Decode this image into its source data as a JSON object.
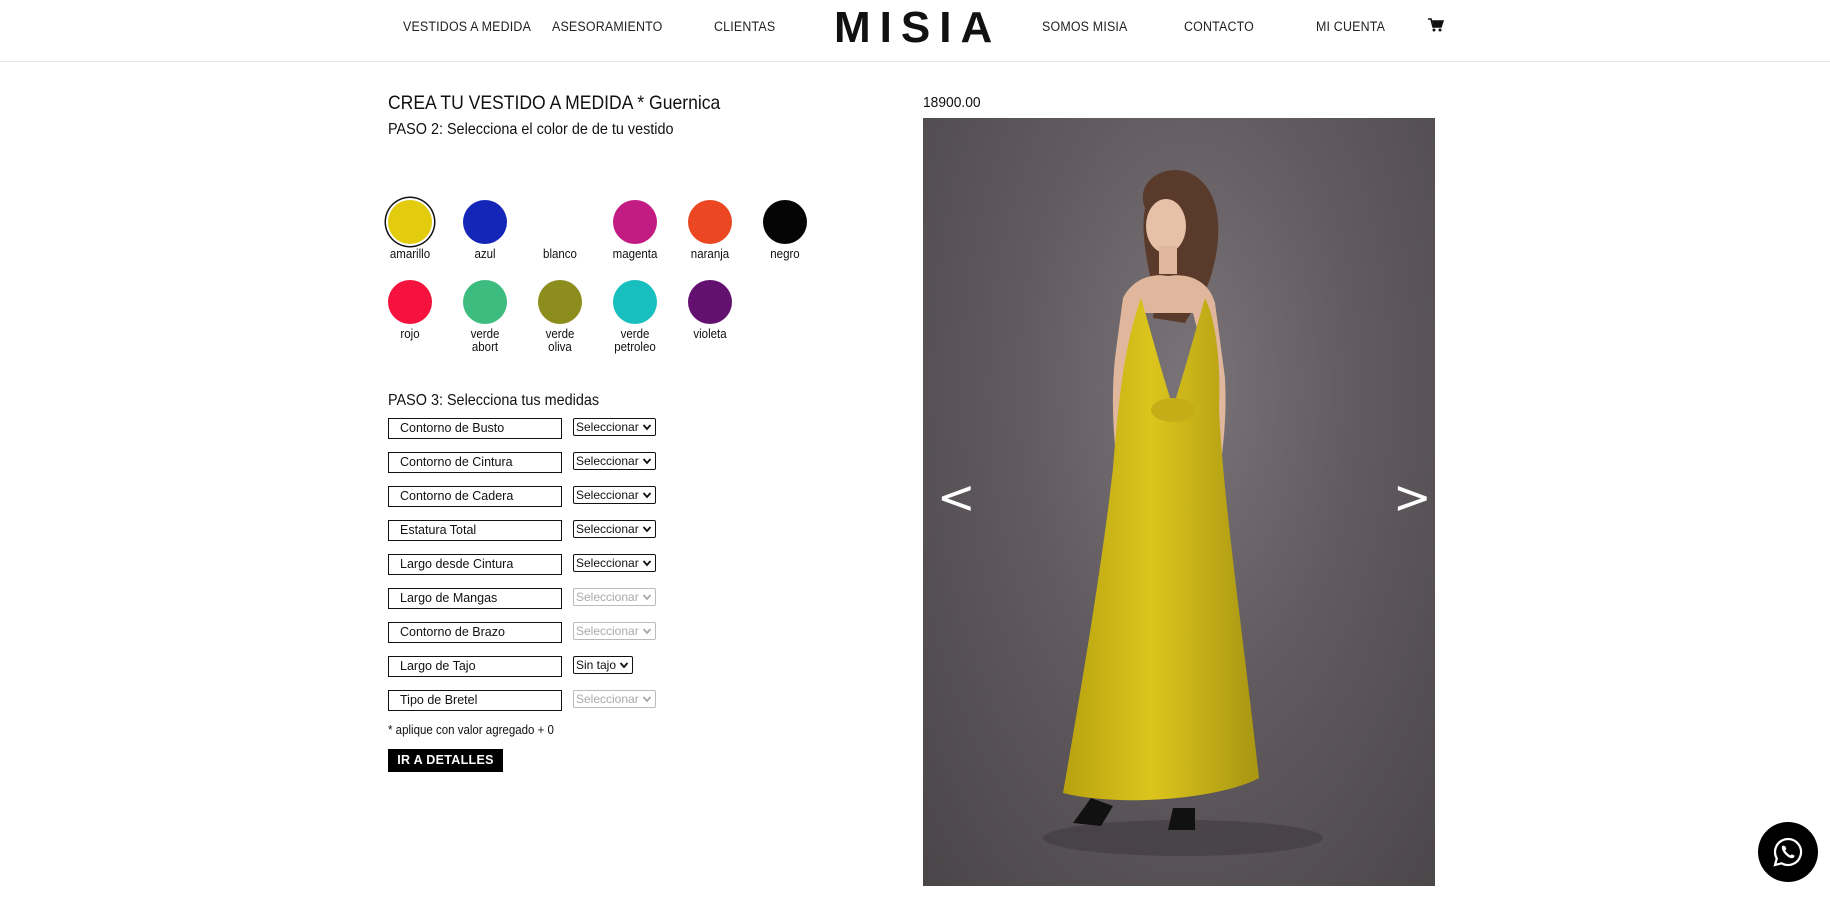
{
  "nav": {
    "vestidos": "VESTIDOS A MEDIDA",
    "asesoramiento": "ASESORAMIENTO",
    "clientas": "CLIENTAS",
    "logo": "MISIA",
    "somos": "SOMOS MISIA",
    "contacto": "CONTACTO",
    "cuenta": "MI CUENTA",
    "cart_icon": "cart-icon"
  },
  "product": {
    "title": "CREA TU VESTIDO A MEDIDA * Guernica",
    "step2": "PASO 2: Selecciona el color de de tu vestido",
    "price": "18900.00"
  },
  "colors": [
    {
      "name": "amarillo",
      "hex": "#e3cc0e",
      "selected": true
    },
    {
      "name": "azul",
      "hex": "#1326b8"
    },
    {
      "name": "blanco",
      "hex": "#ffffff"
    },
    {
      "name": "magenta",
      "hex": "#c21c83"
    },
    {
      "name": "naranja",
      "hex": "#ea4722"
    },
    {
      "name": "negro",
      "hex": "#050505"
    },
    {
      "name": "rojo",
      "hex": "#f5133d"
    },
    {
      "name": "verde abort",
      "hex": "#3cbd7f"
    },
    {
      "name": "verde oliva",
      "hex": "#8c8d1c"
    },
    {
      "name": "verde petroleo",
      "hex": "#17bfbe"
    },
    {
      "name": "violeta",
      "hex": "#63116f"
    }
  ],
  "step3": "PASO 3: Selecciona tus medidas",
  "measurements": [
    {
      "label": "Contorno de Busto",
      "value": "Seleccionar",
      "disabled": false
    },
    {
      "label": "Contorno de Cintura",
      "value": "Seleccionar",
      "disabled": false
    },
    {
      "label": "Contorno de Cadera",
      "value": "Seleccionar",
      "disabled": false
    },
    {
      "label": "Estatura Total",
      "value": "Seleccionar",
      "disabled": false
    },
    {
      "label": "Largo desde Cintura",
      "value": "Seleccionar",
      "disabled": false
    },
    {
      "label": "Largo de Mangas",
      "value": "Seleccionar",
      "disabled": true
    },
    {
      "label": "Contorno de Brazo",
      "value": "Seleccionar",
      "disabled": true
    },
    {
      "label": "Largo de Tajo",
      "value": "Sin tajo",
      "disabled": false
    },
    {
      "label": "Tipo de Bretel",
      "value": "Seleccionar",
      "disabled": true
    }
  ],
  "note": "* aplique con valor agregado + 0",
  "details_button": "IR A DETALLES",
  "gallery": {
    "prev": "<",
    "next": ">",
    "dress_color": "#d8c21a"
  },
  "whatsapp_icon": "whatsapp-icon"
}
